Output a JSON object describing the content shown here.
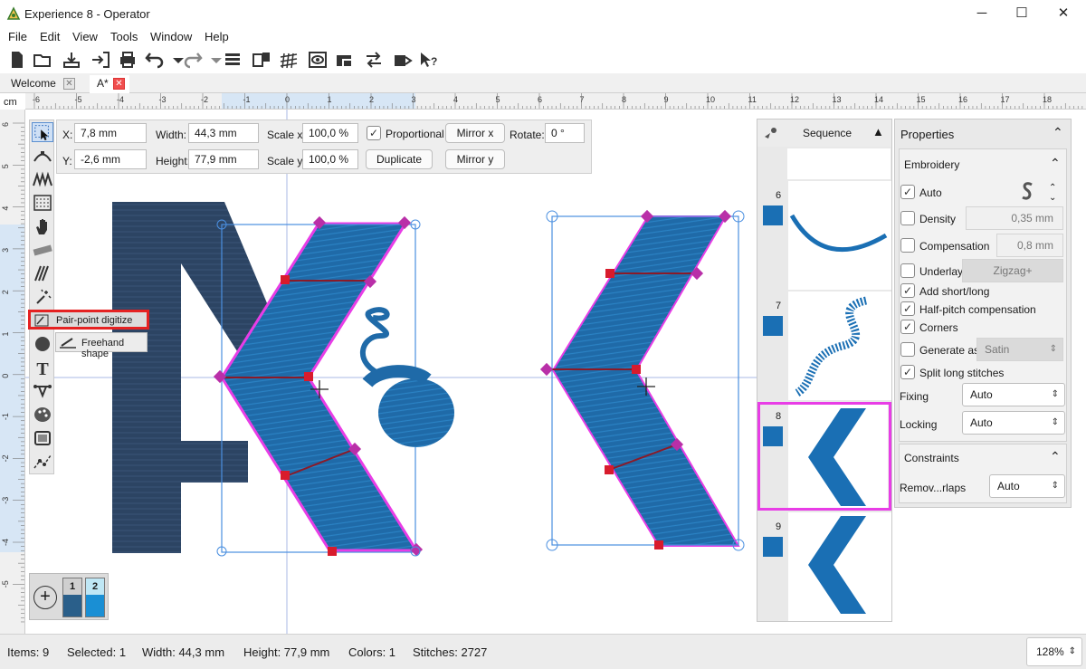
{
  "window": {
    "title": "Experience 8 - Operator",
    "minimize": "─",
    "maximize": "☐",
    "close": "✕"
  },
  "menu": [
    "File",
    "Edit",
    "View",
    "Tools",
    "Window",
    "Help"
  ],
  "tabs": [
    {
      "label": "Welcome"
    },
    {
      "label": "A*"
    }
  ],
  "ruler": {
    "unit": "cm",
    "h_ticks": [
      "-6",
      "-5",
      "-4",
      "-3",
      "-2",
      "-1",
      "0",
      "1",
      "2",
      "3",
      "4",
      "5",
      "6",
      "7",
      "8",
      "9",
      "10",
      "11",
      "12",
      "13",
      "14",
      "15",
      "16",
      "17",
      "18"
    ],
    "v_ticks": [
      "6",
      "5",
      "4",
      "3",
      "2",
      "1",
      "0",
      "-1",
      "-2",
      "-3",
      "-4",
      "-5"
    ]
  },
  "transform": {
    "x_label": "X:",
    "x_value": "7,8 mm",
    "y_label": "Y:",
    "y_value": "-2,6 mm",
    "width_label": "Width:",
    "width_value": "44,3 mm",
    "height_label": "Height:",
    "height_value": "77,9 mm",
    "scalex_label": "Scale x:",
    "scalex_value": "100,0 %",
    "scaley_label": "Scale y:",
    "scaley_value": "100,0 %",
    "proportional_label": "Proportional",
    "proportional_checked": true,
    "duplicate": "Duplicate",
    "mirror_x": "Mirror x",
    "mirror_y": "Mirror y",
    "rotate_label": "Rotate:",
    "rotate_value": "0 °"
  },
  "context": {
    "pair_point": "Pair-point digitize",
    "freehand": "Freehand shape"
  },
  "palette": {
    "items": [
      "1",
      "2"
    ],
    "colors": [
      "#2a5f8a",
      "#1a8fd4"
    ],
    "add": "+"
  },
  "sequence": {
    "title": "Sequence",
    "rows": [
      {
        "num": "6"
      },
      {
        "num": "7"
      },
      {
        "num": "8"
      },
      {
        "num": "9"
      }
    ],
    "selected": "8",
    "accent": "#e83de6"
  },
  "properties": {
    "title": "Properties",
    "embroidery": {
      "title": "Embroidery",
      "auto": {
        "label": "Auto",
        "checked": true
      },
      "density": {
        "label": "Density",
        "value": "0,35 mm",
        "checked": false
      },
      "compensation": {
        "label": "Compensation",
        "value": "0,8 mm",
        "checked": false
      },
      "underlay": {
        "label": "Underlay",
        "value": "Zigzag+",
        "checked": false
      },
      "add_short_long": {
        "label": "Add short/long",
        "checked": true
      },
      "half_pitch": {
        "label": "Half-pitch compensation",
        "checked": true
      },
      "corners": {
        "label": "Corners",
        "checked": true
      },
      "generate_as": {
        "label": "Generate as:",
        "value": "Satin",
        "checked": false
      },
      "split_long": {
        "label": "Split long stitches",
        "checked": true
      },
      "fixing": {
        "label": "Fixing",
        "value": "Auto"
      },
      "locking": {
        "label": "Locking",
        "value": "Auto"
      }
    },
    "constraints": {
      "title": "Constraints",
      "remove_overlaps": {
        "label": "Remov...rlaps",
        "value": "Auto"
      }
    }
  },
  "status": {
    "items": "Items: 9",
    "selected": "Selected: 1",
    "width": "Width: 44,3 mm",
    "height": "Height: 77,9 mm",
    "colors": "Colors: 1",
    "stitches": "Stitches: 2727",
    "zoom": "128%"
  },
  "colors": {
    "stitch_blue": "#1a6fb4",
    "dark_navy": "#2c4463",
    "selection": "#4a8fe0",
    "handle_red": "#d81b2c",
    "handle_purple": "#b92fa8",
    "highlight": "#e52222"
  }
}
